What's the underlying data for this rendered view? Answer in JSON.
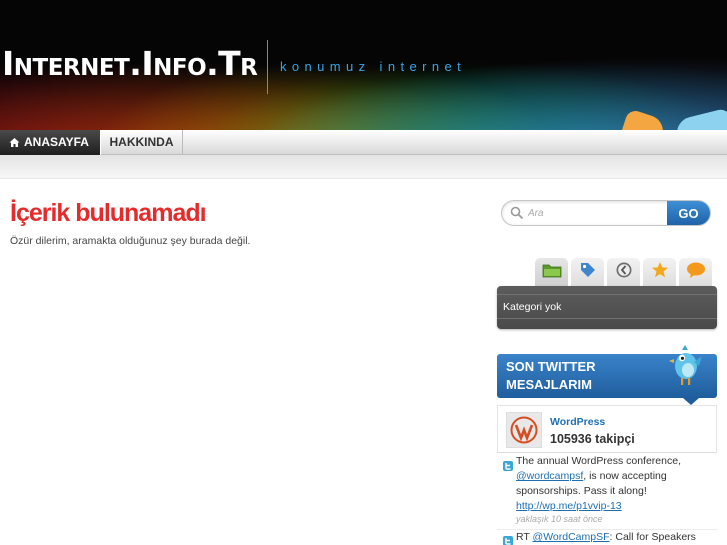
{
  "header": {
    "logo": "Internet.Info.Tr",
    "tagline": "konumuz internet"
  },
  "nav": {
    "items": [
      {
        "label": "ANASAYFA",
        "icon": "home-icon",
        "active": true
      },
      {
        "label": "HAKKINDA",
        "active": false
      }
    ]
  },
  "main": {
    "title": "İçerik bulunamadı",
    "description": "Özür dilerim, aramakta olduğunuz şey burada değil."
  },
  "search": {
    "placeholder": "Ara",
    "button_label": "GO"
  },
  "sidebar_tabs": {
    "icons": [
      "folder-icon",
      "tag-icon",
      "clock-icon",
      "star-icon",
      "comment-icon"
    ],
    "active_index": 0,
    "panel_text": "Kategori yok"
  },
  "twitter": {
    "title": "SON TWITTER MESAJLARIM",
    "profile_name": "WordPress",
    "followers": "105936 takipçi",
    "tweets": [
      {
        "pre": "The annual WordPress conference, ",
        "mention": "@wordcampsf",
        "mid": ", is now accepting sponsorships. Pass it along! ",
        "link": "http://wp.me/p1vvip-13",
        "time": "yaklaşık 10 saat önce"
      },
      {
        "pre": "RT ",
        "mention": "@WordCampSF",
        "mid": ": Call for Speakers",
        "link": "",
        "time": ""
      }
    ]
  },
  "colors": {
    "title_red": "#e52b2b",
    "accent_blue": "#1f6fb2",
    "tagline_blue": "#3aa3e8"
  }
}
